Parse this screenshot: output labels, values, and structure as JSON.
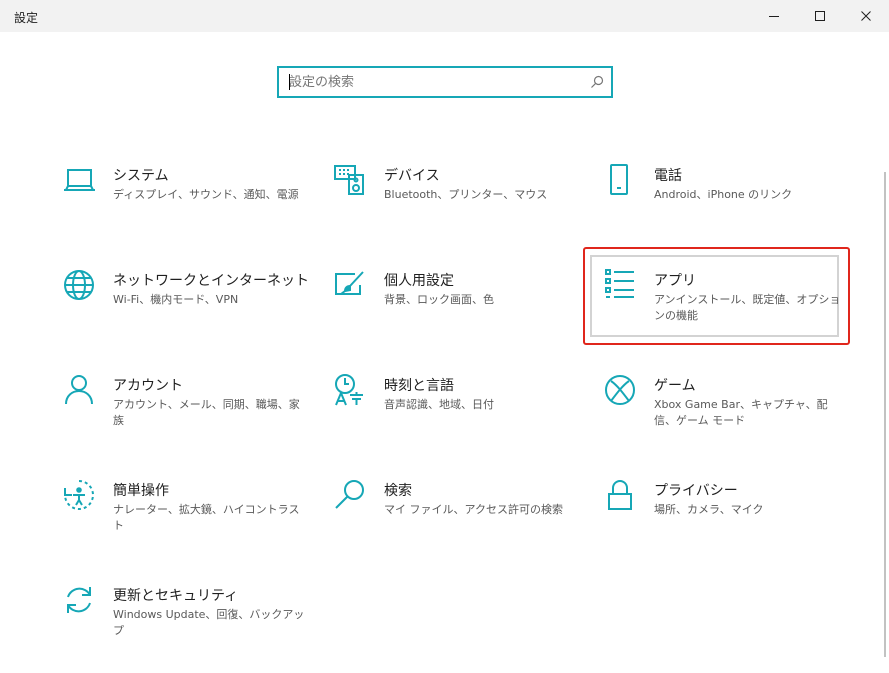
{
  "window": {
    "title": "設定"
  },
  "search": {
    "placeholder": "設定の検索",
    "value": ""
  },
  "colors": {
    "accent": "#16a7b6",
    "highlight": "#e0261c"
  },
  "tiles": [
    {
      "title": "システム",
      "desc": "ディスプレイ、サウンド、通知、電源",
      "icon": "laptop-icon"
    },
    {
      "title": "デバイス",
      "desc": "Bluetooth、プリンター、マウス",
      "icon": "keyboard-speaker-icon"
    },
    {
      "title": "電話",
      "desc": "Android、iPhone のリンク",
      "icon": "phone-icon"
    },
    {
      "title": "ネットワークとインターネット",
      "desc": "Wi-Fi、機内モード、VPN",
      "icon": "globe-icon"
    },
    {
      "title": "個人用設定",
      "desc": "背景、ロック画面、色",
      "icon": "paint-icon"
    },
    {
      "title": "アプリ",
      "desc": "アンインストール、既定値、オプションの機能",
      "icon": "apps-list-icon"
    },
    {
      "title": "アカウント",
      "desc": "アカウント、メール、同期、職場、家族",
      "icon": "person-icon"
    },
    {
      "title": "時刻と言語",
      "desc": "音声認識、地域、日付",
      "icon": "time-language-icon"
    },
    {
      "title": "ゲーム",
      "desc": "Xbox Game Bar、キャプチャ、配信、ゲーム モード",
      "icon": "xbox-icon"
    },
    {
      "title": "簡単操作",
      "desc": "ナレーター、拡大鏡、ハイコントラスト",
      "icon": "ease-of-access-icon"
    },
    {
      "title": "検索",
      "desc": "マイ ファイル、アクセス許可の検索",
      "icon": "magnifier-icon"
    },
    {
      "title": "プライバシー",
      "desc": "場所、カメラ、マイク",
      "icon": "lock-icon"
    },
    {
      "title": "更新とセキュリティ",
      "desc": "Windows Update、回復、バックアップ",
      "icon": "sync-icon"
    }
  ]
}
